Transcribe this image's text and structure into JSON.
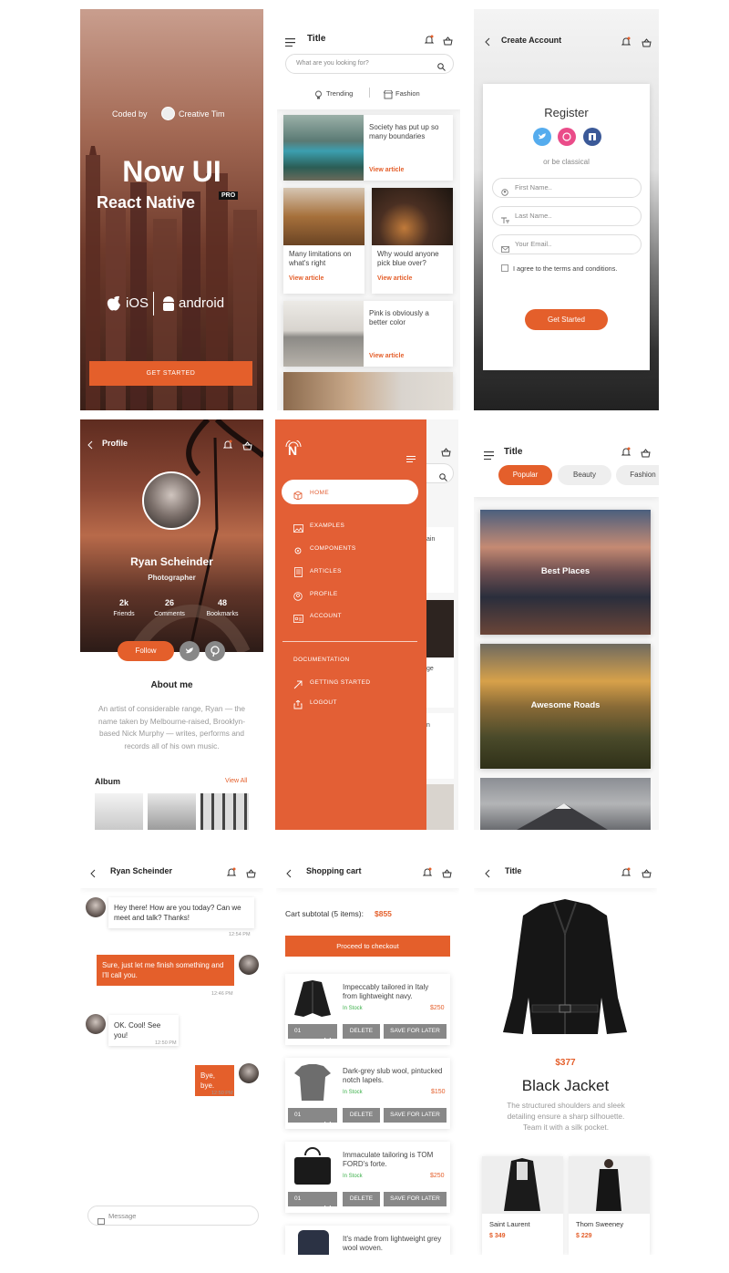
{
  "colors": {
    "accent": "#e45f2b",
    "instock": "#3cb04a",
    "gray": "#888888"
  },
  "landing": {
    "coded_by": "Coded by",
    "author": "Creative Tim",
    "title": "Now UI",
    "subtitle": "React Native",
    "badge": "PRO",
    "ios": "iOS",
    "android": "android",
    "cta": "GET STARTED"
  },
  "articles": {
    "title": "Title",
    "search_placeholder": "What are you looking for?",
    "tabs": [
      "Trending",
      "Fashion"
    ],
    "items": [
      {
        "text": "Society has put up so many boundaries",
        "link": "View article"
      },
      {
        "text": "Many limitations on what's right",
        "link": "View article"
      },
      {
        "text": "Why would anyone pick blue over?",
        "link": "View article"
      },
      {
        "text": "Pink is obviously a better color",
        "link": "View article"
      }
    ]
  },
  "register": {
    "nav_title": "Create Account",
    "heading": "Register",
    "or": "or be classical",
    "first_name": "First Name..",
    "last_name": "Last Name..",
    "email": "Your Email..",
    "terms": "I agree to the terms and conditions.",
    "cta": "Get Started"
  },
  "profile": {
    "nav_title": "Profile",
    "name": "Ryan Scheinder",
    "role": "Photographer",
    "stats": [
      {
        "value": "2k",
        "label": "Friends"
      },
      {
        "value": "26",
        "label": "Comments"
      },
      {
        "value": "48",
        "label": "Bookmarks"
      }
    ],
    "follow": "Follow",
    "about_title": "About me",
    "about_text": "An artist of considerable range, Ryan — the name taken by Melbourne-raised, Brooklyn-based Nick Murphy — writes, performs and records all of his own music.",
    "album": "Album",
    "view_all": "View All"
  },
  "drawer": {
    "logo": "N",
    "items": [
      "HOME",
      "EXAMPLES",
      "COMPONENTS",
      "ARTICLES",
      "PROFILE",
      "ACCOUNT"
    ],
    "section": "DOCUMENTATION",
    "extra": [
      "GETTING STARTED",
      "LOGOUT"
    ],
    "peek": [
      "ain",
      "ge",
      "n"
    ]
  },
  "categories": {
    "title": "Title",
    "tabs": [
      "Popular",
      "Beauty",
      "Fashion"
    ],
    "cards": [
      "Best Places",
      "Awesome Roads"
    ]
  },
  "chat": {
    "nav_title": "Ryan Scheinder",
    "messages": [
      {
        "text": "Hey there! How are you today? Can we meet and talk? Thanks!",
        "time": "12:54 PM"
      },
      {
        "text": "Sure, just let me finish something and I'll call you.",
        "time": "12:46 PM"
      },
      {
        "text": "OK. Cool! See you!",
        "time": "12:50 PM"
      },
      {
        "text": "Bye, bye.",
        "time": "12:50 PM"
      }
    ],
    "input_placeholder": "Message"
  },
  "cart": {
    "nav_title": "Shopping cart",
    "subtotal_label": "Cart subtotal (5 items):",
    "subtotal_value": "$855",
    "checkout": "Proceed to checkout",
    "qty": "01",
    "delete": "DELETE",
    "save": "SAVE FOR LATER",
    "in_stock": "In Stock",
    "items": [
      {
        "title": "Impeccably tailored in Italy from lightweight navy.",
        "price": "$250"
      },
      {
        "title": "Dark-grey slub wool, pintucked notch lapels.",
        "price": "$150"
      },
      {
        "title": "Immaculate tailoring is TOM FORD's forte.",
        "price": "$250"
      },
      {
        "title": "It's made from lightweight grey wool woven."
      }
    ]
  },
  "product": {
    "nav_title": "Title",
    "price": "$377",
    "name": "Black Jacket",
    "description": "The structured shoulders and sleek detailing ensure a sharp silhouette. Team it with a silk pocket.",
    "related": [
      {
        "name": "Saint Laurent",
        "price": "$ 349"
      },
      {
        "name": "Thom Sweeney",
        "price": "$ 229"
      }
    ]
  }
}
